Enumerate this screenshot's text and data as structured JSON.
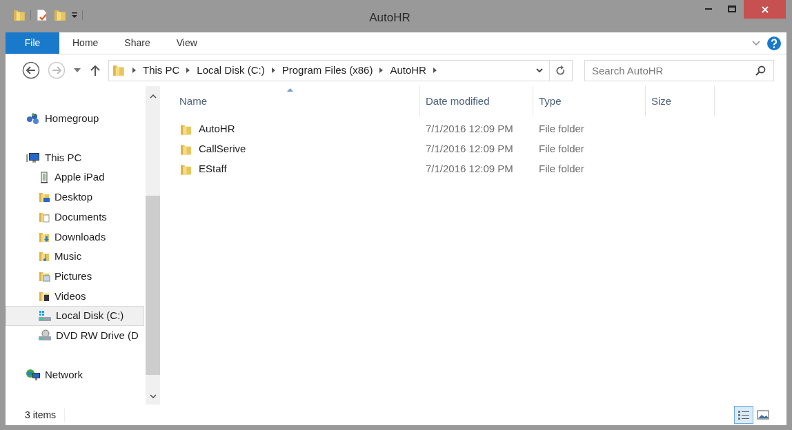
{
  "window": {
    "title": "AutoHR"
  },
  "ribbon_tabs": [
    {
      "label": "File",
      "selected": true
    },
    {
      "label": "Home",
      "selected": false
    },
    {
      "label": "Share",
      "selected": false
    },
    {
      "label": "View",
      "selected": false
    }
  ],
  "address": {
    "segments": [
      "This PC",
      "Local Disk (C:)",
      "Program Files (x86)",
      "AutoHR"
    ]
  },
  "search": {
    "placeholder": "Search AutoHR"
  },
  "sidebar": {
    "items": [
      {
        "label": "Homegroup",
        "kind": "homegroup",
        "selected": false
      },
      {
        "label": "This PC",
        "kind": "pc",
        "selected": false,
        "children": [
          {
            "label": "Apple iPad",
            "kind": "device",
            "selected": false
          },
          {
            "label": "Desktop",
            "kind": "desktop",
            "selected": false
          },
          {
            "label": "Documents",
            "kind": "documents",
            "selected": false
          },
          {
            "label": "Downloads",
            "kind": "downloads",
            "selected": false
          },
          {
            "label": "Music",
            "kind": "music",
            "selected": false
          },
          {
            "label": "Pictures",
            "kind": "pictures",
            "selected": false
          },
          {
            "label": "Videos",
            "kind": "videos",
            "selected": false
          },
          {
            "label": "Local Disk (C:)",
            "kind": "disk",
            "selected": true
          },
          {
            "label": "DVD RW Drive (D",
            "kind": "dvd",
            "selected": false
          }
        ]
      },
      {
        "label": "Network",
        "kind": "network",
        "selected": false
      }
    ]
  },
  "table": {
    "columns": [
      "Name",
      "Date modified",
      "Type",
      "Size"
    ],
    "rows": [
      {
        "name": "AutoHR",
        "date": "7/1/2016 12:09 PM",
        "type": "File folder"
      },
      {
        "name": "CallSerive",
        "date": "7/1/2016 12:09 PM",
        "type": "File folder"
      },
      {
        "name": "EStaff",
        "date": "7/1/2016 12:09 PM",
        "type": "File folder"
      }
    ]
  },
  "status_bar": {
    "text": "3 items"
  },
  "view_buttons": [
    {
      "kind": "details",
      "selected": true
    },
    {
      "kind": "large-icons",
      "selected": false
    }
  ]
}
